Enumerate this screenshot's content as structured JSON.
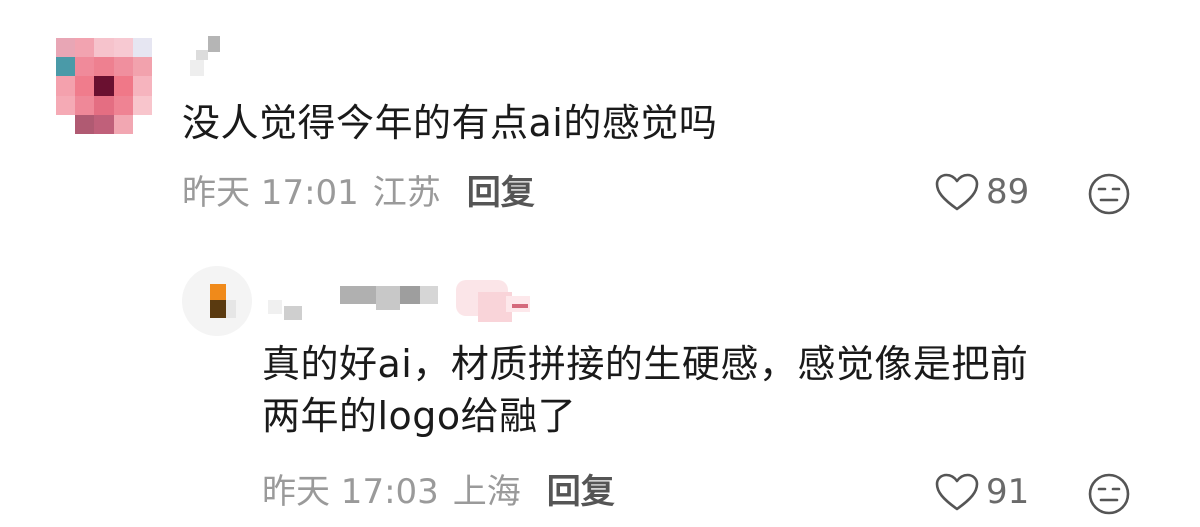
{
  "comments": [
    {
      "text": "没人觉得今年的有点ai的感觉吗",
      "time": "昨天 17:01",
      "location": "江苏",
      "reply_label": "回复",
      "likes": "89"
    }
  ],
  "replies": [
    {
      "text_line1": "真的好ai，材质拼接的生硬感，感觉像是把前",
      "text_line2": "两年的logo给融了",
      "time": "昨天 17:03",
      "location": "上海",
      "reply_label": "回复",
      "likes": "91"
    }
  ],
  "colors": {
    "text": "#1a1a1a",
    "meta": "#9a9a9a",
    "reply": "#555555",
    "icon": "#555555"
  },
  "icons": {
    "like": "heart-outline-icon",
    "dislike": "unhappy-face-icon"
  }
}
